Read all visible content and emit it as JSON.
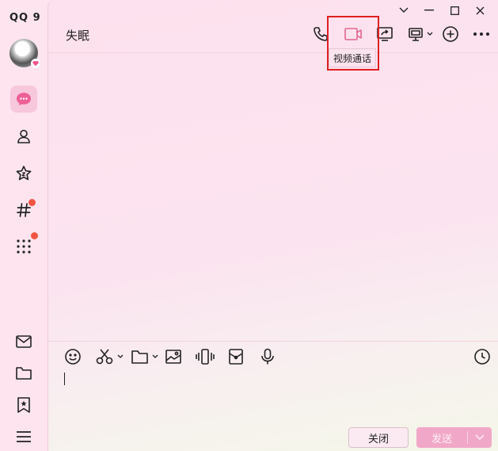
{
  "app": {
    "logo_text": "QQ 9",
    "colors": {
      "accent": "#f1a8c8",
      "highlight_border": "#e02020",
      "notification_dot": "#f05543"
    }
  },
  "sidebar": {
    "items": [
      {
        "name": "chat",
        "icon": "chat-bubble-icon",
        "active": true
      },
      {
        "name": "contacts",
        "icon": "person-icon"
      },
      {
        "name": "favorites",
        "icon": "star-icon"
      },
      {
        "name": "channels",
        "icon": "hashtag-icon",
        "badge": true
      },
      {
        "name": "apps",
        "icon": "grid-icon",
        "badge": true
      }
    ],
    "bottom_items": [
      {
        "name": "mail",
        "icon": "mail-icon"
      },
      {
        "name": "folder",
        "icon": "folder-icon"
      },
      {
        "name": "bookmark",
        "icon": "bookmark-icon"
      },
      {
        "name": "menu",
        "icon": "hamburger-icon"
      }
    ]
  },
  "header": {
    "title": "失眠",
    "tooltip": "视频通话",
    "actions": [
      "phone-icon",
      "video-call-icon",
      "screen-share-icon",
      "remote-desktop-icon",
      "add-icon",
      "more-icon"
    ]
  },
  "input_toolbar": {
    "tools": [
      "emoji-icon",
      "scissors-icon",
      "folder-icon",
      "image-icon",
      "vibrate-icon",
      "red-packet-icon",
      "microphone-icon",
      "history-icon"
    ]
  },
  "footer": {
    "close_label": "关闭",
    "send_label": "发送"
  }
}
